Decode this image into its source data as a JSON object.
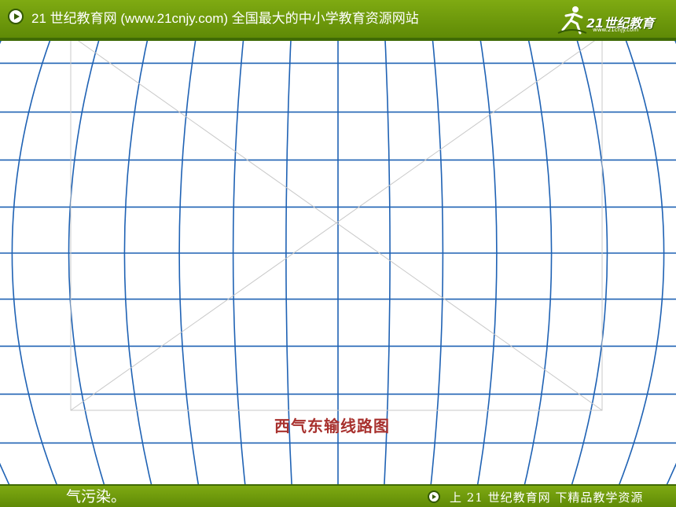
{
  "header": {
    "title": "21 世纪教育网 (www.21cnjy.com)  全国最大的中小学教育资源网站",
    "logo_text": "21世纪教育",
    "logo_url": "www.21cnjy.com"
  },
  "slide": {
    "image_caption": "西气东输线路图",
    "body_text": "气污染。"
  },
  "footer": {
    "slogan": "上 21 世纪教育网  下精品教学资源"
  },
  "colors": {
    "bar_green": "#6a960b",
    "grid_blue": "#1f62b4",
    "caption_red": "#a8312e"
  },
  "icons": {
    "header_play": "play-circle-icon",
    "footer_play": "play-circle-icon",
    "logo": "runner-logo-icon"
  }
}
